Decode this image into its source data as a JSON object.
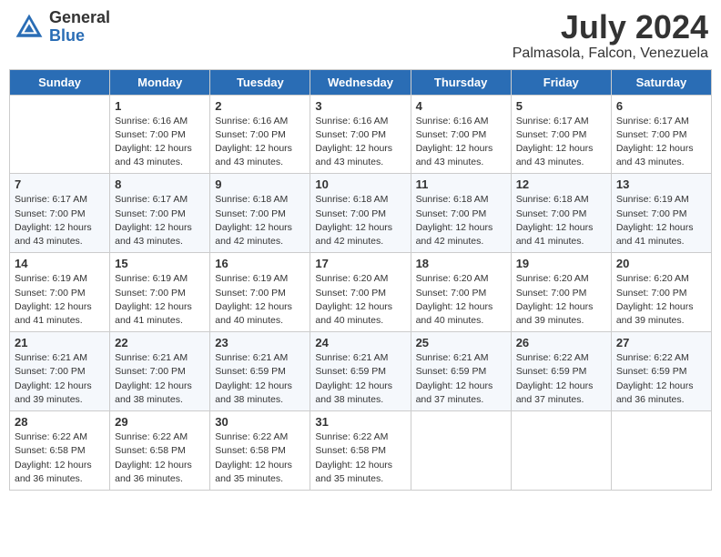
{
  "logo": {
    "general": "General",
    "blue": "Blue"
  },
  "title": "July 2024",
  "location": "Palmasola, Falcon, Venezuela",
  "days_of_week": [
    "Sunday",
    "Monday",
    "Tuesday",
    "Wednesday",
    "Thursday",
    "Friday",
    "Saturday"
  ],
  "weeks": [
    [
      {
        "day": "",
        "detail": ""
      },
      {
        "day": "1",
        "detail": "Sunrise: 6:16 AM\nSunset: 7:00 PM\nDaylight: 12 hours\nand 43 minutes."
      },
      {
        "day": "2",
        "detail": "Sunrise: 6:16 AM\nSunset: 7:00 PM\nDaylight: 12 hours\nand 43 minutes."
      },
      {
        "day": "3",
        "detail": "Sunrise: 6:16 AM\nSunset: 7:00 PM\nDaylight: 12 hours\nand 43 minutes."
      },
      {
        "day": "4",
        "detail": "Sunrise: 6:16 AM\nSunset: 7:00 PM\nDaylight: 12 hours\nand 43 minutes."
      },
      {
        "day": "5",
        "detail": "Sunrise: 6:17 AM\nSunset: 7:00 PM\nDaylight: 12 hours\nand 43 minutes."
      },
      {
        "day": "6",
        "detail": "Sunrise: 6:17 AM\nSunset: 7:00 PM\nDaylight: 12 hours\nand 43 minutes."
      }
    ],
    [
      {
        "day": "7",
        "detail": ""
      },
      {
        "day": "8",
        "detail": "Sunrise: 6:17 AM\nSunset: 7:00 PM\nDaylight: 12 hours\nand 43 minutes."
      },
      {
        "day": "9",
        "detail": "Sunrise: 6:18 AM\nSunset: 7:00 PM\nDaylight: 12 hours\nand 42 minutes."
      },
      {
        "day": "10",
        "detail": "Sunrise: 6:18 AM\nSunset: 7:00 PM\nDaylight: 12 hours\nand 42 minutes."
      },
      {
        "day": "11",
        "detail": "Sunrise: 6:18 AM\nSunset: 7:00 PM\nDaylight: 12 hours\nand 42 minutes."
      },
      {
        "day": "12",
        "detail": "Sunrise: 6:18 AM\nSunset: 7:00 PM\nDaylight: 12 hours\nand 41 minutes."
      },
      {
        "day": "13",
        "detail": "Sunrise: 6:19 AM\nSunset: 7:00 PM\nDaylight: 12 hours\nand 41 minutes."
      }
    ],
    [
      {
        "day": "14",
        "detail": ""
      },
      {
        "day": "15",
        "detail": "Sunrise: 6:19 AM\nSunset: 7:00 PM\nDaylight: 12 hours\nand 41 minutes."
      },
      {
        "day": "16",
        "detail": "Sunrise: 6:19 AM\nSunset: 7:00 PM\nDaylight: 12 hours\nand 40 minutes."
      },
      {
        "day": "17",
        "detail": "Sunrise: 6:20 AM\nSunset: 7:00 PM\nDaylight: 12 hours\nand 40 minutes."
      },
      {
        "day": "18",
        "detail": "Sunrise: 6:20 AM\nSunset: 7:00 PM\nDaylight: 12 hours\nand 40 minutes."
      },
      {
        "day": "19",
        "detail": "Sunrise: 6:20 AM\nSunset: 7:00 PM\nDaylight: 12 hours\nand 39 minutes."
      },
      {
        "day": "20",
        "detail": "Sunrise: 6:20 AM\nSunset: 7:00 PM\nDaylight: 12 hours\nand 39 minutes."
      }
    ],
    [
      {
        "day": "21",
        "detail": ""
      },
      {
        "day": "22",
        "detail": "Sunrise: 6:21 AM\nSunset: 7:00 PM\nDaylight: 12 hours\nand 38 minutes."
      },
      {
        "day": "23",
        "detail": "Sunrise: 6:21 AM\nSunset: 6:59 PM\nDaylight: 12 hours\nand 38 minutes."
      },
      {
        "day": "24",
        "detail": "Sunrise: 6:21 AM\nSunset: 6:59 PM\nDaylight: 12 hours\nand 38 minutes."
      },
      {
        "day": "25",
        "detail": "Sunrise: 6:21 AM\nSunset: 6:59 PM\nDaylight: 12 hours\nand 37 minutes."
      },
      {
        "day": "26",
        "detail": "Sunrise: 6:22 AM\nSunset: 6:59 PM\nDaylight: 12 hours\nand 37 minutes."
      },
      {
        "day": "27",
        "detail": "Sunrise: 6:22 AM\nSunset: 6:59 PM\nDaylight: 12 hours\nand 36 minutes."
      }
    ],
    [
      {
        "day": "28",
        "detail": "Sunrise: 6:22 AM\nSunset: 6:58 PM\nDaylight: 12 hours\nand 36 minutes."
      },
      {
        "day": "29",
        "detail": "Sunrise: 6:22 AM\nSunset: 6:58 PM\nDaylight: 12 hours\nand 36 minutes."
      },
      {
        "day": "30",
        "detail": "Sunrise: 6:22 AM\nSunset: 6:58 PM\nDaylight: 12 hours\nand 35 minutes."
      },
      {
        "day": "31",
        "detail": "Sunrise: 6:22 AM\nSunset: 6:58 PM\nDaylight: 12 hours\nand 35 minutes."
      },
      {
        "day": "",
        "detail": ""
      },
      {
        "day": "",
        "detail": ""
      },
      {
        "day": "",
        "detail": ""
      }
    ]
  ],
  "week1_sunday_detail": "Sunrise: 6:17 AM\nSunset: 7:00 PM\nDaylight: 12 hours\nand 43 minutes.",
  "week2_sunday_detail": "Sunrise: 6:17 AM\nSunset: 7:00 PM\nDaylight: 12 hours\nand 43 minutes.",
  "week3_sunday_detail": "Sunrise: 6:19 AM\nSunset: 7:00 PM\nDaylight: 12 hours\nand 41 minutes.",
  "week4_sunday_detail": "Sunrise: 6:21 AM\nSunset: 7:00 PM\nDaylight: 12 hours\nand 39 minutes."
}
